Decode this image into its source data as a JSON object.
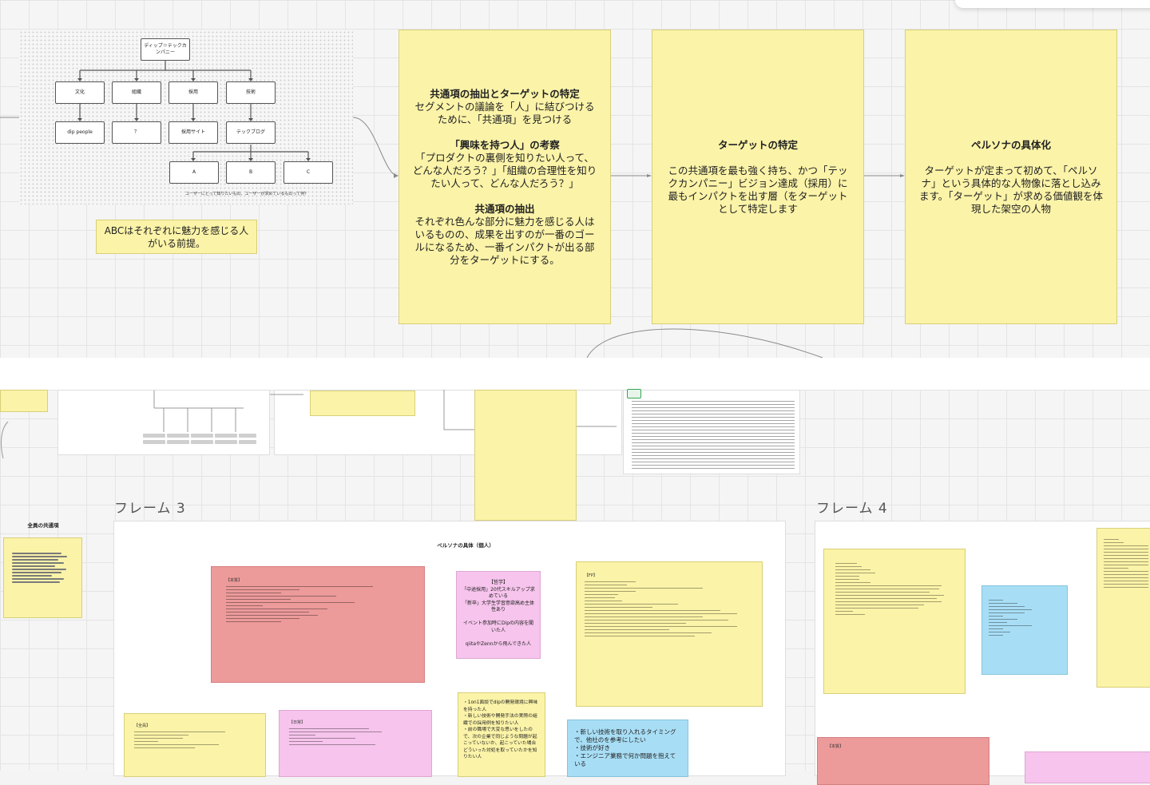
{
  "diagram": {
    "root": "ディップ＝テックカンパニー",
    "level1": [
      "文化",
      "組織",
      "採用",
      "技術"
    ],
    "level2": [
      "dip people",
      "？",
      "採用サイト",
      "テックブログ"
    ],
    "level3": [
      "A",
      "B",
      "C"
    ],
    "caption": "ユーザーにとって知りたいもの、ユーザーが求めているものって何？"
  },
  "premise_note": "ABCはそれぞれに魅力を感じる人がいる前提。",
  "sticky1": {
    "title1": "共通項の抽出とターゲットの特定",
    "body1": "セグメントの議論を「人」に結びつけるために、「共通項」を見つける",
    "title2": "「興味を持つ人」の考察",
    "body2": "「プロダクトの裏側を知りたい人って、どんな人だろう？」「組織の合理性を知りたい人って、どんな人だろう？」",
    "title3": "共通項の抽出",
    "body3": "それぞれ色んな部分に魅力を感じる人はいるものの、成果を出すのが一番のゴールになるため、一番インパクトが出る部分をターゲットにする。"
  },
  "sticky2": {
    "title": "ターゲットの特定",
    "body": "この共通項を最も強く持ち、かつ「テックカンパニー」ビジョン達成（採用）に最もインパクトを出す層（をターゲットとして特定します"
  },
  "sticky3": {
    "title": "ペルソナの具体化",
    "body": "ターゲットが定まって初めて、「ペルソナ」という具体的な人物像に落とし込みます。「ターゲット」が求める価値観を体現した架空の人物"
  },
  "frame3": {
    "title": "フレーム 3",
    "heading": "ペルソナの具体（個人）",
    "pink_note": "【哲学】\n「中途採用」20代スキルアップ求めている\n「新卒」大学生学習意欲高め主体性あり\n\nイベント参加時にDipの内容を聞いた人\n\nqiitaやZennから飛んできた人",
    "yellow_center": "・1on1面談でdipの開発環境に興味を持った人\n・新しい技術や開発手法の実際の組織での採用例を知りたい人\n・前の職場で大変な思いをしたので、次の企業で同じような問題が起こっていないか、起こっていた場合どういった対処を取っていたかを知りたい人",
    "blue_note": "・新しい技術を取り入れるタイミングで、他社のを参考にしたい\n・技術が好き\n・エンジニア業務で何か問題を抱えている",
    "red_title": "【本質】",
    "fp_title": "【FP】",
    "small_header_left": "【全員】",
    "pink_bottom_title": "【日常】"
  },
  "side_note_title": "全員の共通項",
  "frame4": {
    "title": "フレーム 4",
    "red_bottom_title": "【本質】"
  }
}
